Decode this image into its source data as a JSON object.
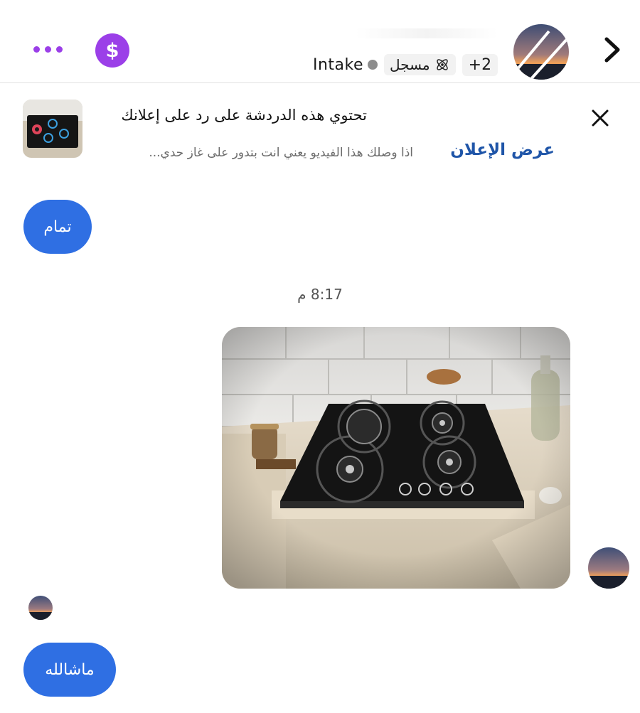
{
  "header": {
    "tag_intake": "Intake",
    "tag_registered": "مسجل",
    "tag_count": "+2",
    "colors": {
      "accent": "#9b3fe8"
    },
    "icons": [
      "more-icon",
      "dollar-icon",
      "chevron-right-icon",
      "atom-icon"
    ]
  },
  "ad": {
    "title": "تحتوي هذه الدردشة على رد على إعلانك",
    "subtitle": "اذا وصلك هذا الفيديو يعني انت بتدور على غاز حدي...",
    "view_label": "عرض الإعلان",
    "colors": {
      "link": "#1f55a8"
    }
  },
  "messages": {
    "first_reply": "تمام",
    "timestamp": "8:17 م",
    "last_reply": "ماشالله",
    "colors": {
      "bubble": "#2f6fe3"
    }
  }
}
